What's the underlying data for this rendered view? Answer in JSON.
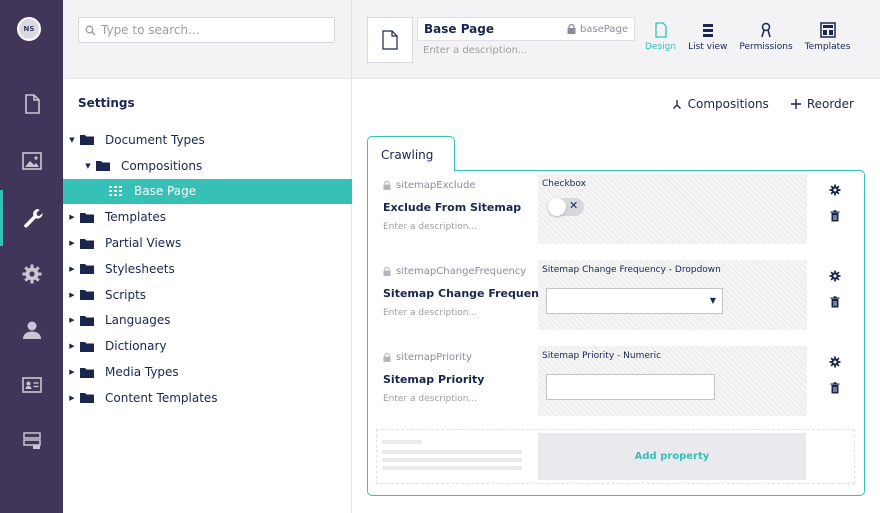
{
  "app": {
    "logo_text": "NS"
  },
  "sections": [
    {
      "icon": "content-icon"
    },
    {
      "icon": "media-icon"
    },
    {
      "icon": "settings-wrench-icon",
      "active": true
    },
    {
      "icon": "packages-gear-icon"
    },
    {
      "icon": "users-icon"
    },
    {
      "icon": "members-icon"
    },
    {
      "icon": "forms-icon"
    }
  ],
  "tree": {
    "search_placeholder": "Type to search...",
    "title": "Settings",
    "nodes": [
      {
        "label": "Document Types",
        "expanded": true
      },
      {
        "label": "Compositions",
        "expanded": true
      },
      {
        "label": "Base Page",
        "selected": true
      },
      {
        "label": "Templates"
      },
      {
        "label": "Partial Views"
      },
      {
        "label": "Stylesheets"
      },
      {
        "label": "Scripts"
      },
      {
        "label": "Languages"
      },
      {
        "label": "Dictionary"
      },
      {
        "label": "Media Types"
      },
      {
        "label": "Content Templates"
      }
    ]
  },
  "editor": {
    "name": "Base Page",
    "alias": "basePage",
    "description_placeholder": "Enter a description...",
    "tools": [
      {
        "label": "Design",
        "active": true
      },
      {
        "label": "List view"
      },
      {
        "label": "Permissions"
      },
      {
        "label": "Templates"
      }
    ],
    "actions": {
      "compositions": "Compositions",
      "reorder": "Reorder"
    },
    "tab": "Crawling",
    "properties": [
      {
        "alias": "sitemapExclude",
        "label": "Exclude From Sitemap",
        "description": "Enter a description...",
        "type": "Checkbox"
      },
      {
        "alias": "sitemapChangeFrequency",
        "label": "Sitemap Change Frequency",
        "description": "Enter a description...",
        "type": "Sitemap Change Frequency - Dropdown"
      },
      {
        "alias": "sitemapPriority",
        "label": "Sitemap Priority",
        "description": "Enter a description...",
        "type": "Sitemap Priority - Numeric"
      }
    ],
    "add_property": "Add property",
    "accent": "#35c1b6",
    "nav_bg": "#413659"
  }
}
